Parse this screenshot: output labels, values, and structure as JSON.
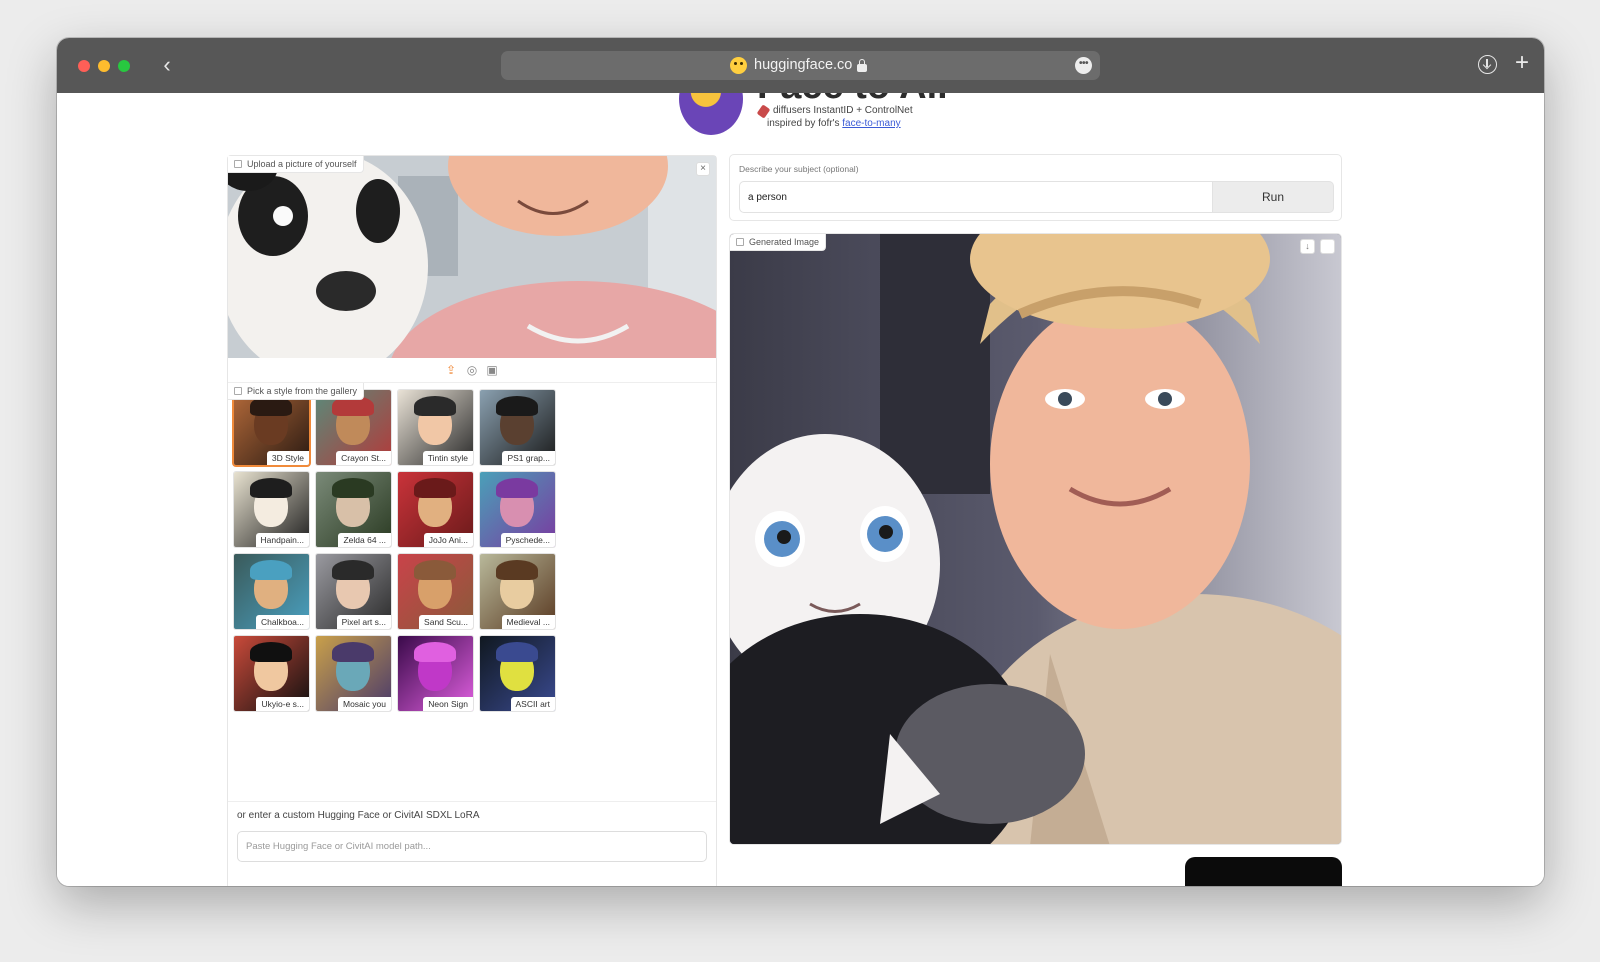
{
  "browser": {
    "url": "huggingface.co",
    "back_icon": "chevron-left-icon",
    "more_icon": "ellipsis-icon",
    "download_icon": "download-icon",
    "new_tab_icon": "plus-icon"
  },
  "header": {
    "title": "Face to All",
    "subtitle_line1": "diffusers InstantID + ControlNet",
    "subtitle_line2_prefix": "inspired by fofr's ",
    "subtitle_link": "face-to-many"
  },
  "upload": {
    "label": "Upload a picture of yourself",
    "clear_icon": "close-icon",
    "toolbar_icons": [
      "upload-icon",
      "webcam-icon",
      "clipboard-icon"
    ]
  },
  "gallery": {
    "label": "Pick a style from the gallery",
    "selected_index": 0,
    "items": [
      {
        "caption": "3D Style"
      },
      {
        "caption": "Crayon St..."
      },
      {
        "caption": "Tintin style"
      },
      {
        "caption": "PS1 grap..."
      },
      {
        "caption": "Handpain..."
      },
      {
        "caption": "Zelda 64 ..."
      },
      {
        "caption": "JoJo Ani..."
      },
      {
        "caption": "Pyschede..."
      },
      {
        "caption": "Chalkboa..."
      },
      {
        "caption": "Pixel art s..."
      },
      {
        "caption": "Sand Scu..."
      },
      {
        "caption": "Medieval ..."
      },
      {
        "caption": "Ukyio-e s..."
      },
      {
        "caption": "Mosaic you"
      },
      {
        "caption": "Neon Sign"
      },
      {
        "caption": "ASCII art"
      }
    ]
  },
  "lora": {
    "label": "or enter a custom Hugging Face or CivitAI SDXL LoRA",
    "placeholder": "Paste Hugging Face or CivitAI model path...",
    "value": ""
  },
  "prompt": {
    "label": "Describe your subject (optional)",
    "value": "a person",
    "run_label": "Run"
  },
  "output": {
    "label": "Generated Image"
  },
  "colors": {
    "accent": "#f08a3a",
    "toolbar": "#575757",
    "share_button": "#0b0b0b"
  }
}
